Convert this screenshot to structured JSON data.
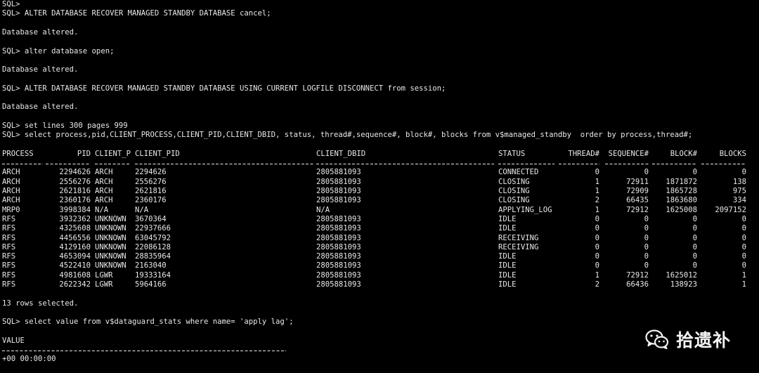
{
  "session": [
    "SQL>",
    "SQL> ALTER DATABASE RECOVER MANAGED STANDBY DATABASE cancel;",
    "",
    "Database altered.",
    "",
    "SQL> alter database open;",
    "",
    "Database altered.",
    "",
    "SQL> ALTER DATABASE RECOVER MANAGED STANDBY DATABASE USING CURRENT LOGFILE DISCONNECT from session;",
    "",
    "Database altered.",
    "",
    "SQL> set lines 300 pages 999",
    "SQL> select process,pid,CLIENT_PROCESS,CLIENT_PID,CLIENT_DBID, status, thread#,sequence#, block#, blocks from v$managed_standby  order by process,thread#;",
    ""
  ],
  "result_table": {
    "headers": [
      "PROCESS",
      "PID",
      "CLIENT_P",
      "CLIENT_PID",
      "CLIENT_DBID",
      "STATUS",
      "THREAD#",
      "SEQUENCE#",
      "BLOCK#",
      "BLOCKS"
    ],
    "rows": [
      [
        "ARCH",
        "2294626",
        "ARCH",
        "2294626",
        "2805881093",
        "CONNECTED",
        "0",
        "0",
        "0",
        "0"
      ],
      [
        "ARCH",
        "2556276",
        "ARCH",
        "2556276",
        "2805881093",
        "CLOSING",
        "1",
        "72911",
        "1871872",
        "138"
      ],
      [
        "ARCH",
        "2621816",
        "ARCH",
        "2621816",
        "2805881093",
        "CLOSING",
        "1",
        "72909",
        "1865728",
        "975"
      ],
      [
        "ARCH",
        "2360176",
        "ARCH",
        "2360176",
        "2805881093",
        "CLOSING",
        "2",
        "66435",
        "1863680",
        "334"
      ],
      [
        "MRP0",
        "3998384",
        "N/A",
        "N/A",
        "N/A",
        "APPLYING_LOG",
        "1",
        "72912",
        "1625008",
        "2097152"
      ],
      [
        "RFS",
        "3932362",
        "UNKNOWN",
        "3670364",
        "2805881093",
        "IDLE",
        "0",
        "0",
        "0",
        "0"
      ],
      [
        "RFS",
        "4325608",
        "UNKNOWN",
        "22937666",
        "2805881093",
        "IDLE",
        "0",
        "0",
        "0",
        "0"
      ],
      [
        "RFS",
        "4456556",
        "UNKNOWN",
        "63045792",
        "2805881093",
        "RECEIVING",
        "0",
        "0",
        "0",
        "0"
      ],
      [
        "RFS",
        "4129160",
        "UNKNOWN",
        "22086128",
        "2805881093",
        "RECEIVING",
        "0",
        "0",
        "0",
        "0"
      ],
      [
        "RFS",
        "4653094",
        "UNKNOWN",
        "28835964",
        "2805881093",
        "IDLE",
        "0",
        "0",
        "0",
        "0"
      ],
      [
        "RFS",
        "4522410",
        "UNKNOWN",
        "2163040",
        "2805881093",
        "IDLE",
        "0",
        "0",
        "0",
        "0"
      ],
      [
        "RFS",
        "4981608",
        "LGWR",
        "19333164",
        "2805881093",
        "IDLE",
        "1",
        "72912",
        "1625012",
        "1"
      ],
      [
        "RFS",
        "2622342",
        "LGWR",
        "5964166",
        "2805881093",
        "IDLE",
        "2",
        "66436",
        "138923",
        "1"
      ]
    ]
  },
  "after_table": [
    "",
    "13 rows selected.",
    "",
    "SQL> select value from v$dataguard_stats where name= 'apply lag';",
    "",
    "VALUE"
  ],
  "value_result": "+00 00:00:00",
  "watermark": {
    "icon": "wechat-icon",
    "text": "拾遗补"
  },
  "colors": {
    "background": "#000000",
    "foreground": "#e8e8e8"
  }
}
